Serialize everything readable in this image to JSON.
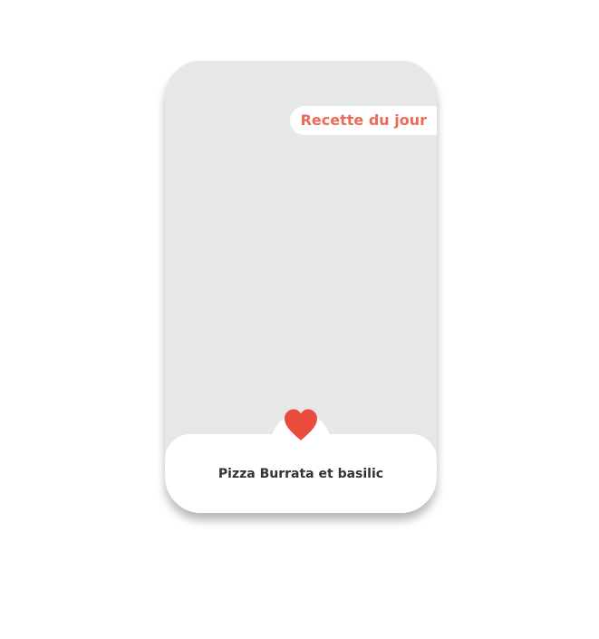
{
  "card": {
    "badge_label": "Recette du jour",
    "recipe_title": "Pizza Burrata et basilic",
    "favorite_icon": "heart-icon",
    "image_placeholder_color": "#e7e7e7"
  },
  "colors": {
    "accent": "#ee6a57",
    "heart": "#e94c3d",
    "title_text": "#333333"
  }
}
